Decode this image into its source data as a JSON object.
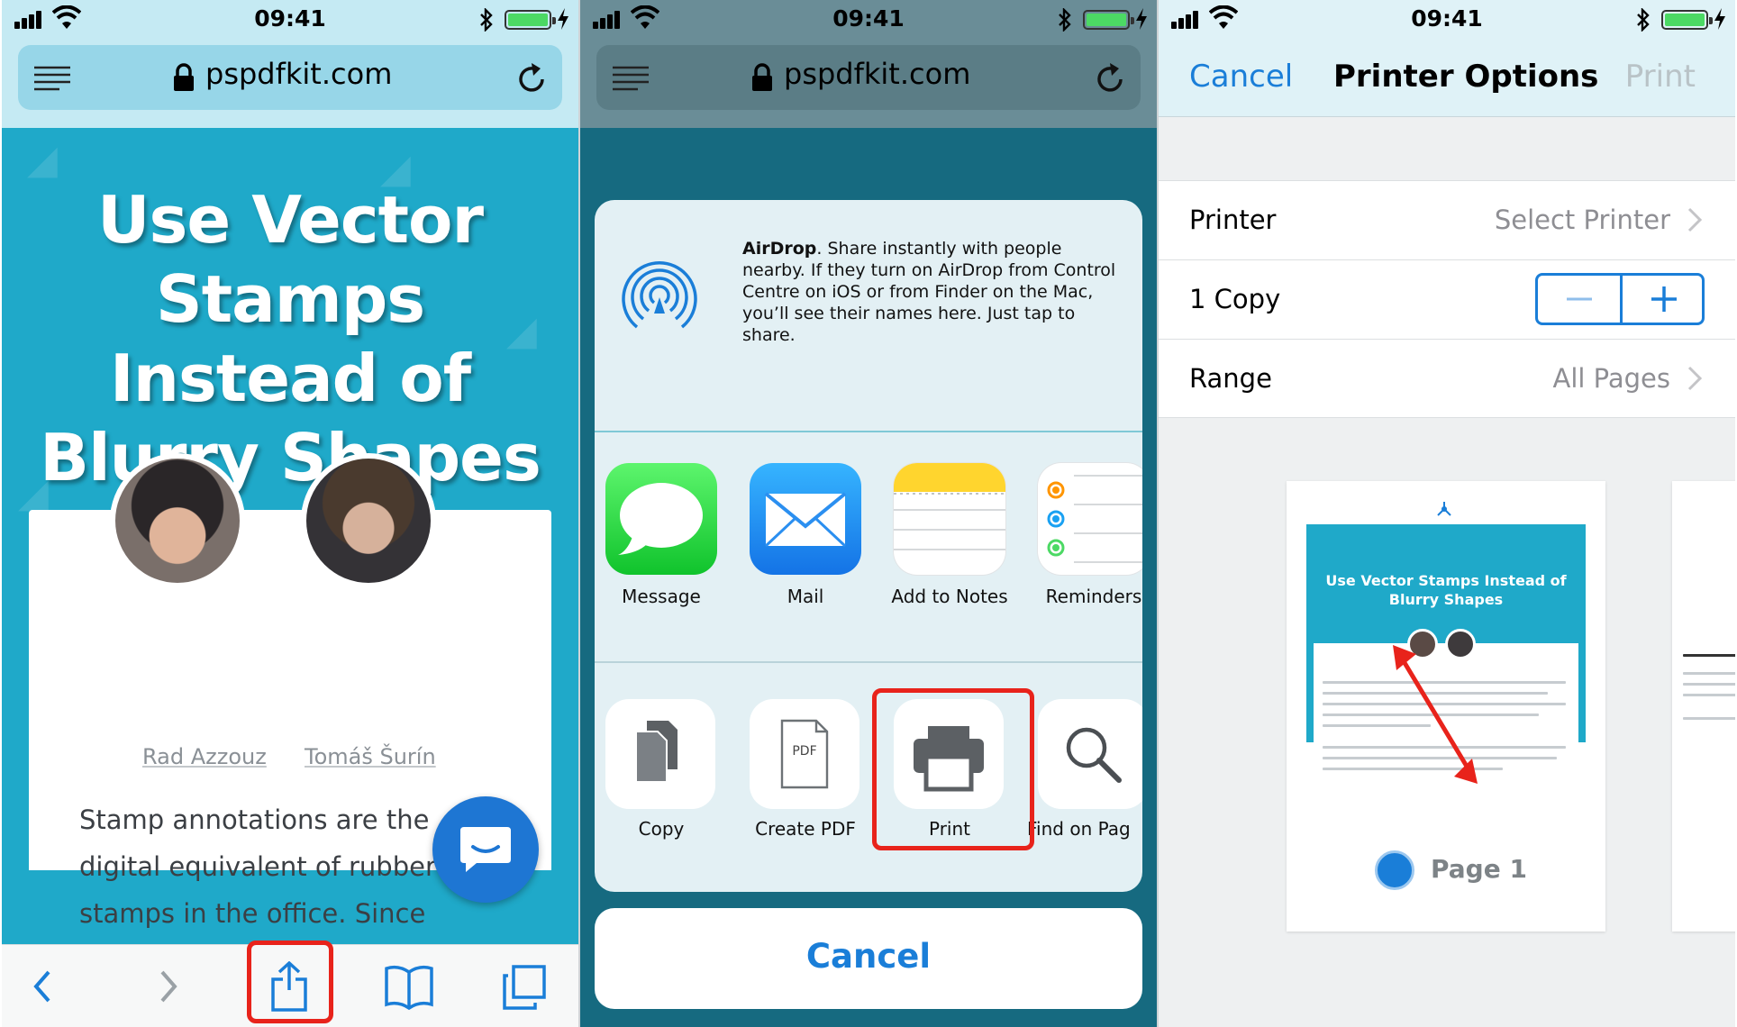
{
  "status_bar": {
    "time": "09:41"
  },
  "browser": {
    "url": "pspdfkit.com",
    "article_title": "Use Vector Stamps Instead of Blurry Shapes",
    "authors": [
      "Rad Azzouz",
      "Tomáš Šurín"
    ],
    "article_text": "Stamp annotations are the digital equivalent of rubber stamps in the office. Since"
  },
  "share_sheet": {
    "airdrop_title": "AirDrop",
    "airdrop_description": ". Share instantly with people nearby. If they turn on AirDrop from Control Centre on iOS or from Finder on the Mac, you’ll see their names here. Just tap to share.",
    "apps": [
      {
        "label": "Message",
        "icon": "message-icon"
      },
      {
        "label": "Mail",
        "icon": "mail-icon"
      },
      {
        "label": "Add to Notes",
        "icon": "notes-icon"
      },
      {
        "label": "Reminders",
        "icon": "reminders-icon"
      }
    ],
    "actions": [
      {
        "label": "Copy",
        "icon": "copy-icon"
      },
      {
        "label": "Create PDF",
        "icon": "pdf-icon"
      },
      {
        "label": "Print",
        "icon": "printer-icon"
      },
      {
        "label": "Find on Pag",
        "icon": "search-icon"
      }
    ],
    "cancel_label": "Cancel",
    "pdf_icon_text": "PDF"
  },
  "printer_options": {
    "cancel_label": "Cancel",
    "title": "Printer Options",
    "print_label": "Print",
    "rows": {
      "printer": {
        "label": "Printer",
        "value": "Select Printer"
      },
      "copies": {
        "label": "1 Copy"
      },
      "range": {
        "label": "Range",
        "value": "All Pages"
      }
    },
    "preview": {
      "mini_title": "Use Vector Stamps Instead of Blurry Shapes",
      "page_label": "Page 1"
    }
  },
  "colors": {
    "accent": "#1a7ed8",
    "highlight": "#e8231b",
    "hero": "#1fa9c9"
  }
}
